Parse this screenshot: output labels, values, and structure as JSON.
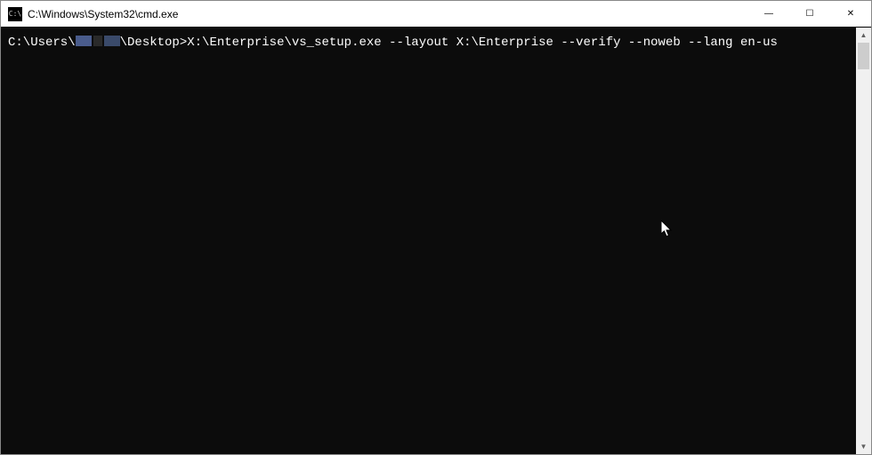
{
  "titlebar": {
    "icon_label": "C:\\",
    "title": "C:\\Windows\\System32\\cmd.exe"
  },
  "window_controls": {
    "minimize": "—",
    "maximize": "☐",
    "close": "✕"
  },
  "terminal": {
    "prompt_prefix": "C:\\Users\\",
    "prompt_suffix": "\\Desktop>",
    "command": "X:\\Enterprise\\vs_setup.exe --layout X:\\Enterprise --verify --noweb --lang en-us"
  },
  "scrollbar": {
    "up": "▲",
    "down": "▼"
  }
}
